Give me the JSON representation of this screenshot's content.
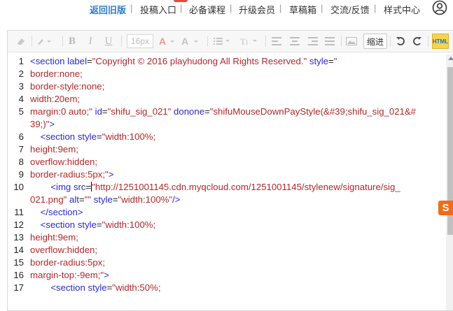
{
  "nav": {
    "items": [
      {
        "label": "返回旧版",
        "active": true
      },
      {
        "label": "投稿入口",
        "active": false
      },
      {
        "label": "必备课程",
        "active": false
      },
      {
        "label": "升级会员",
        "active": false
      },
      {
        "label": "草稿箱",
        "active": false
      },
      {
        "label": "交流/反馈",
        "active": false
      },
      {
        "label": "样式中心",
        "active": false
      }
    ],
    "user_icon": "user-circle-icon"
  },
  "toolbar": {
    "font_size": "16px",
    "indent_label": "缩进",
    "html_label": "HTML",
    "icons": [
      "eraser-icon",
      "format-brush-icon",
      "bold-icon",
      "italic-icon",
      "underline-icon",
      "font-color-icon",
      "highlight-icon",
      "list-icon",
      "text-height-icon",
      "align-left-icon",
      "align-center-icon",
      "align-right-icon",
      "justify-icon",
      "image-icon",
      "undo-icon",
      "redo-icon"
    ]
  },
  "editor": {
    "lines": [
      {
        "n": "1",
        "segs": [
          [
            "t",
            "<section "
          ],
          [
            "a",
            "label"
          ],
          [
            "k",
            "="
          ],
          [
            "v",
            "\"Copyright © 2016 playhudong All Rights Reserved.\""
          ],
          [
            "k",
            " "
          ],
          [
            "a",
            "style"
          ],
          [
            "k",
            "="
          ],
          [
            "v",
            "\""
          ]
        ]
      },
      {
        "n": "",
        "segs": [
          [
            "v",
            "border:none;"
          ]
        ]
      },
      {
        "n": "",
        "segs": [
          [
            "v",
            "border-style:none;"
          ]
        ]
      },
      {
        "n": "",
        "segs": [
          [
            "v",
            "width:20em;"
          ]
        ]
      },
      {
        "n": "",
        "segs": [
          [
            "v",
            "margin:0 auto;\""
          ],
          [
            "k",
            " "
          ],
          [
            "a",
            "id"
          ],
          [
            "k",
            "="
          ],
          [
            "v",
            "\"shifu_sig_021\""
          ],
          [
            "k",
            " "
          ],
          [
            "a",
            "donone"
          ],
          [
            "k",
            "="
          ],
          [
            "v",
            "\"shifuMouseDownPayStyle(&#39;shifu_sig_021&#"
          ]
        ]
      },
      {
        "n": "",
        "segs": [
          [
            "v",
            "39;)\""
          ],
          [
            "t",
            ">"
          ]
        ]
      },
      {
        "n": "",
        "segs": [
          [
            "k",
            "    "
          ],
          [
            "t",
            "<section "
          ],
          [
            "a",
            "style"
          ],
          [
            "k",
            "="
          ],
          [
            "v",
            "\"width:100%;"
          ]
        ]
      },
      {
        "n": "",
        "segs": [
          [
            "v",
            "height:9em;"
          ]
        ]
      },
      {
        "n": "",
        "segs": [
          [
            "v",
            "overflow:hidden;"
          ]
        ]
      },
      {
        "n": "",
        "segs": [
          [
            "v",
            "border-radius:5px;\""
          ],
          [
            "t",
            ">"
          ]
        ]
      },
      {
        "n": "",
        "segs": [
          [
            "k",
            "        "
          ],
          [
            "t",
            "<img "
          ],
          [
            "a",
            "src"
          ],
          [
            "k",
            "="
          ],
          [
            "cursor",
            ""
          ],
          [
            "v",
            "\"http://1251001145.cdn.myqcloud.com/1251001145/stylenew/signature/sig_"
          ]
        ]
      },
      {
        "n": "",
        "segs": [
          [
            "v",
            "021.png\""
          ],
          [
            "k",
            " "
          ],
          [
            "a",
            "alt"
          ],
          [
            "k",
            "="
          ],
          [
            "v",
            "\"\""
          ],
          [
            "k",
            " "
          ],
          [
            "a",
            "style"
          ],
          [
            "k",
            "="
          ],
          [
            "v",
            "\"width:100%\""
          ],
          [
            "t",
            "/>"
          ]
        ]
      },
      {
        "n": "",
        "segs": [
          [
            "k",
            "    "
          ],
          [
            "t",
            "</section>"
          ]
        ]
      },
      {
        "n": "",
        "segs": [
          [
            "k",
            "    "
          ],
          [
            "t",
            "<section "
          ],
          [
            "a",
            "style"
          ],
          [
            "k",
            "="
          ],
          [
            "v",
            "\"width:100%;"
          ]
        ]
      },
      {
        "n": "",
        "segs": [
          [
            "v",
            "height:9em;"
          ]
        ]
      },
      {
        "n": "",
        "segs": [
          [
            "v",
            "overflow:hidden;"
          ]
        ]
      },
      {
        "n": "",
        "segs": [
          [
            "v",
            "border-radius:5px;"
          ]
        ]
      },
      {
        "n": "",
        "segs": [
          [
            "v",
            "margin-top:-9em;\""
          ],
          [
            "t",
            ">"
          ]
        ]
      },
      {
        "n": "",
        "segs": [
          [
            "k",
            "        "
          ],
          [
            "t",
            "<section "
          ],
          [
            "a",
            "style"
          ],
          [
            "k",
            "="
          ],
          [
            "v",
            "\"width:50%;"
          ]
        ]
      }
    ],
    "line_numbers": [
      "1",
      "2",
      "3",
      "4",
      "5",
      "",
      "6",
      "7",
      "8",
      "9",
      "10",
      "",
      "11",
      "12",
      "13",
      "14",
      "15",
      "16",
      "17"
    ]
  },
  "colors": {
    "active_nav": "#2f7cc4",
    "tag": "#2a2ac5",
    "value": "#b2282a",
    "logo": "#f26b1b"
  },
  "logo_letter": "S"
}
